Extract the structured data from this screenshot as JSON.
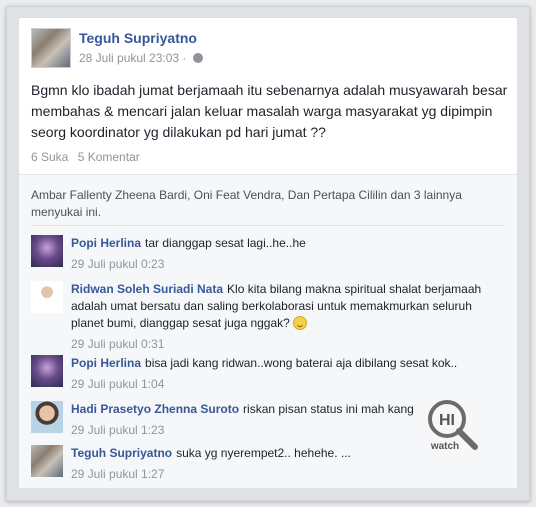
{
  "post": {
    "author": "Teguh Supriyatno",
    "timestamp": "28 Juli pukul 23:03 ·",
    "privacy_icon": "globe-icon",
    "text": "Bgmn klo ibadah jumat berjamaah itu sebenarnya adalah musyawarah besar membahas & mencari jalan keluar masalah warga masyarakat yg dipimpin seorg koordinator yg dilakukan pd hari jumat ??",
    "likes_count": "6 Suka",
    "comments_count": "5 Komentar"
  },
  "likes_summary": "Ambar Fallenty Zheena Bardi, Oni Feat Vendra, Dan Pertapa Cililin dan 3 lainnya menyukai ini.",
  "comments": [
    {
      "name": "Popi Herlina",
      "text": "tar dianggap sesat lagi..he..he",
      "time": "29 Juli pukul 0:23"
    },
    {
      "name": "Ridwan Soleh Suriadi Nata",
      "text": "Klo kita bilang makna spiritual shalat berjamaah adalah umat bersatu dan saling berkolaborasi untuk memakmurkan seluruh planet bumi, dianggap sesat juga nggak?",
      "time": "29 Juli pukul 0:31"
    },
    {
      "name": "Popi Herlina",
      "text": "bisa jadi kang ridwan..wong baterai aja dibilang sesat kok..",
      "time": "29 Juli pukul 1:04"
    },
    {
      "name": "Hadi Prasetyo Zhenna Suroto",
      "text": "riskan pisan status ini mah kang",
      "time": "29 Juli pukul 1:23"
    },
    {
      "name": "Teguh Supriyatno",
      "text": "suka yg nyerempet2.. hehehe. ...",
      "time": "29 Juli pukul 1:27"
    }
  ],
  "watermark": {
    "line1": "HI",
    "line2": "watch"
  },
  "colors": {
    "link": "#365899",
    "meta": "#90949c",
    "text": "#1d2129",
    "ufi_bg": "#f6f7f9"
  }
}
